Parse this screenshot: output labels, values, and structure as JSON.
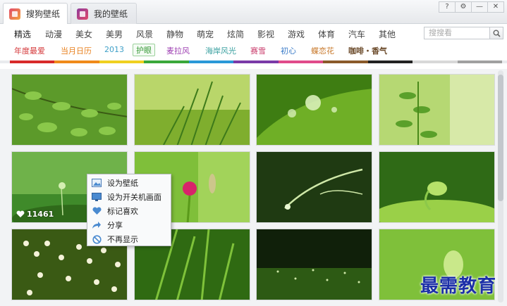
{
  "tabs": [
    {
      "label": "搜狗壁纸"
    },
    {
      "label": "我的壁纸"
    }
  ],
  "window_buttons": [
    "?",
    "⚙",
    "—",
    "✕"
  ],
  "categories": [
    "精选",
    "动漫",
    "美女",
    "美男",
    "风景",
    "静物",
    "萌宠",
    "炫简",
    "影视",
    "游戏",
    "体育",
    "汽车",
    "其他"
  ],
  "search": {
    "placeholder": "搜搜看"
  },
  "topics": [
    {
      "label": "年度最爱",
      "color": "#d4383a"
    },
    {
      "label": "当月日历",
      "color": "#e8801e"
    },
    {
      "label": "2013",
      "color": "#3fa0c8"
    },
    {
      "label": "护眼",
      "color": "#3a9b3a"
    },
    {
      "label": "麦拉风",
      "color": "#9b3ab0"
    },
    {
      "label": "海岸风光",
      "color": "#3aa0a0"
    },
    {
      "label": "赛雪",
      "color": "#c83a6a"
    },
    {
      "label": "初心",
      "color": "#3a7bc8"
    },
    {
      "label": "蝶恋花",
      "color": "#c8782a"
    },
    {
      "label": "咖啡・香气",
      "color": "#6b4a2a"
    }
  ],
  "color_strip": [
    "#d82a2a",
    "#f08a1a",
    "#f0d020",
    "#3aa83a",
    "#2a98d8",
    "#7a3aa8",
    "#e04a8a",
    "#8a5a2a",
    "#222222",
    "#d8d8d8",
    "#a0a0a0"
  ],
  "thumb_likes": "11461",
  "context_menu": [
    {
      "label": "设为壁纸",
      "icon": "picture-icon"
    },
    {
      "label": "设为开关机画面",
      "icon": "monitor-icon"
    },
    {
      "label": "标记喜欢",
      "icon": "heart-icon"
    },
    {
      "label": "分享",
      "icon": "share-arrow-icon"
    },
    {
      "label": "不再显示",
      "icon": "no-entry-icon"
    }
  ],
  "watermark": "最需教育"
}
